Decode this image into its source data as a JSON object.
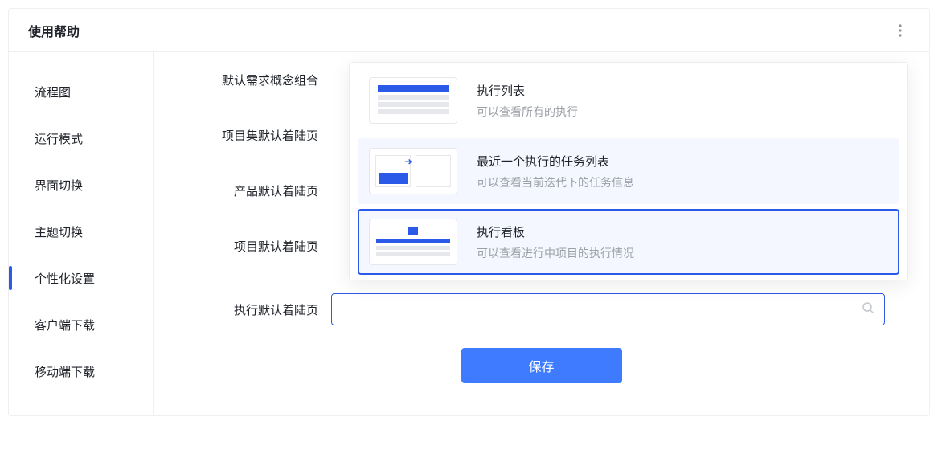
{
  "header": {
    "title": "使用帮助"
  },
  "sidebar": {
    "items": [
      {
        "label": "流程图"
      },
      {
        "label": "运行模式"
      },
      {
        "label": "界面切换"
      },
      {
        "label": "主题切换"
      },
      {
        "label": "个性化设置"
      },
      {
        "label": "客户端下载"
      },
      {
        "label": "移动端下载"
      }
    ],
    "active_index": 4
  },
  "form": {
    "rows": [
      {
        "label": "默认需求概念组合"
      },
      {
        "label": "项目集默认着陆页"
      },
      {
        "label": "产品默认着陆页"
      },
      {
        "label": "项目默认着陆页"
      },
      {
        "label": "执行默认着陆页"
      }
    ],
    "search_placeholder": ""
  },
  "dropdown": {
    "options": [
      {
        "title": "执行列表",
        "desc": "可以查看所有的执行",
        "thumb": "list"
      },
      {
        "title": "最近一个执行的任务列表",
        "desc": "可以查看当前迭代下的任务信息",
        "thumb": "task"
      },
      {
        "title": "执行看板",
        "desc": "可以查看进行中项目的执行情况",
        "thumb": "board"
      }
    ],
    "hover_index": 1,
    "selected_index": 2
  },
  "actions": {
    "save": "保存"
  }
}
